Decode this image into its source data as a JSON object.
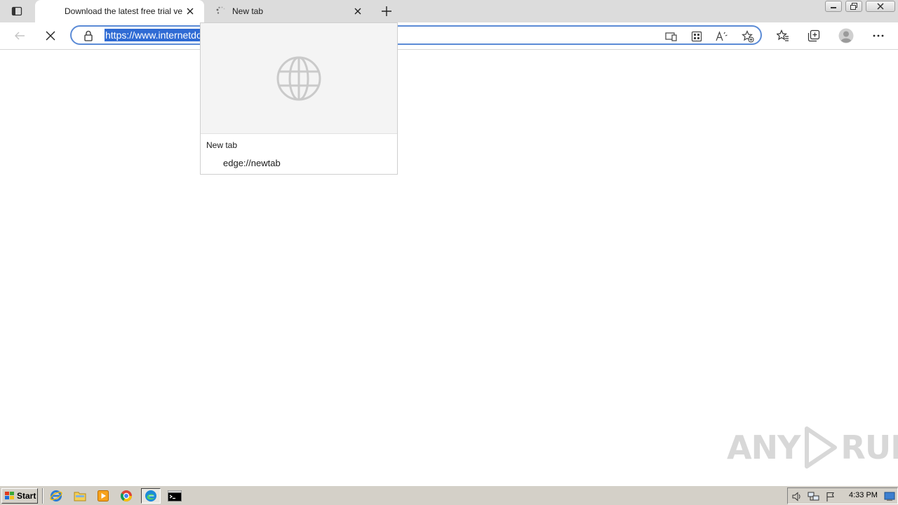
{
  "browser": {
    "tabs": [
      {
        "title": "Download the latest free trial ve",
        "active": true
      },
      {
        "title": "New tab",
        "active": false,
        "loading": true
      }
    ],
    "address": {
      "url": "https://www.internetdo"
    }
  },
  "hovercard": {
    "title": "New tab",
    "url": "edge://newtab"
  },
  "watermark": {
    "left": "ANY",
    "right": "RUN"
  },
  "taskbar": {
    "start_label": "Start",
    "clock": "4:33 PM"
  },
  "colors": {
    "address_border": "#5b8bd6",
    "url_selection": "#2f6bd4",
    "taskbar": "#d4d0c8"
  }
}
